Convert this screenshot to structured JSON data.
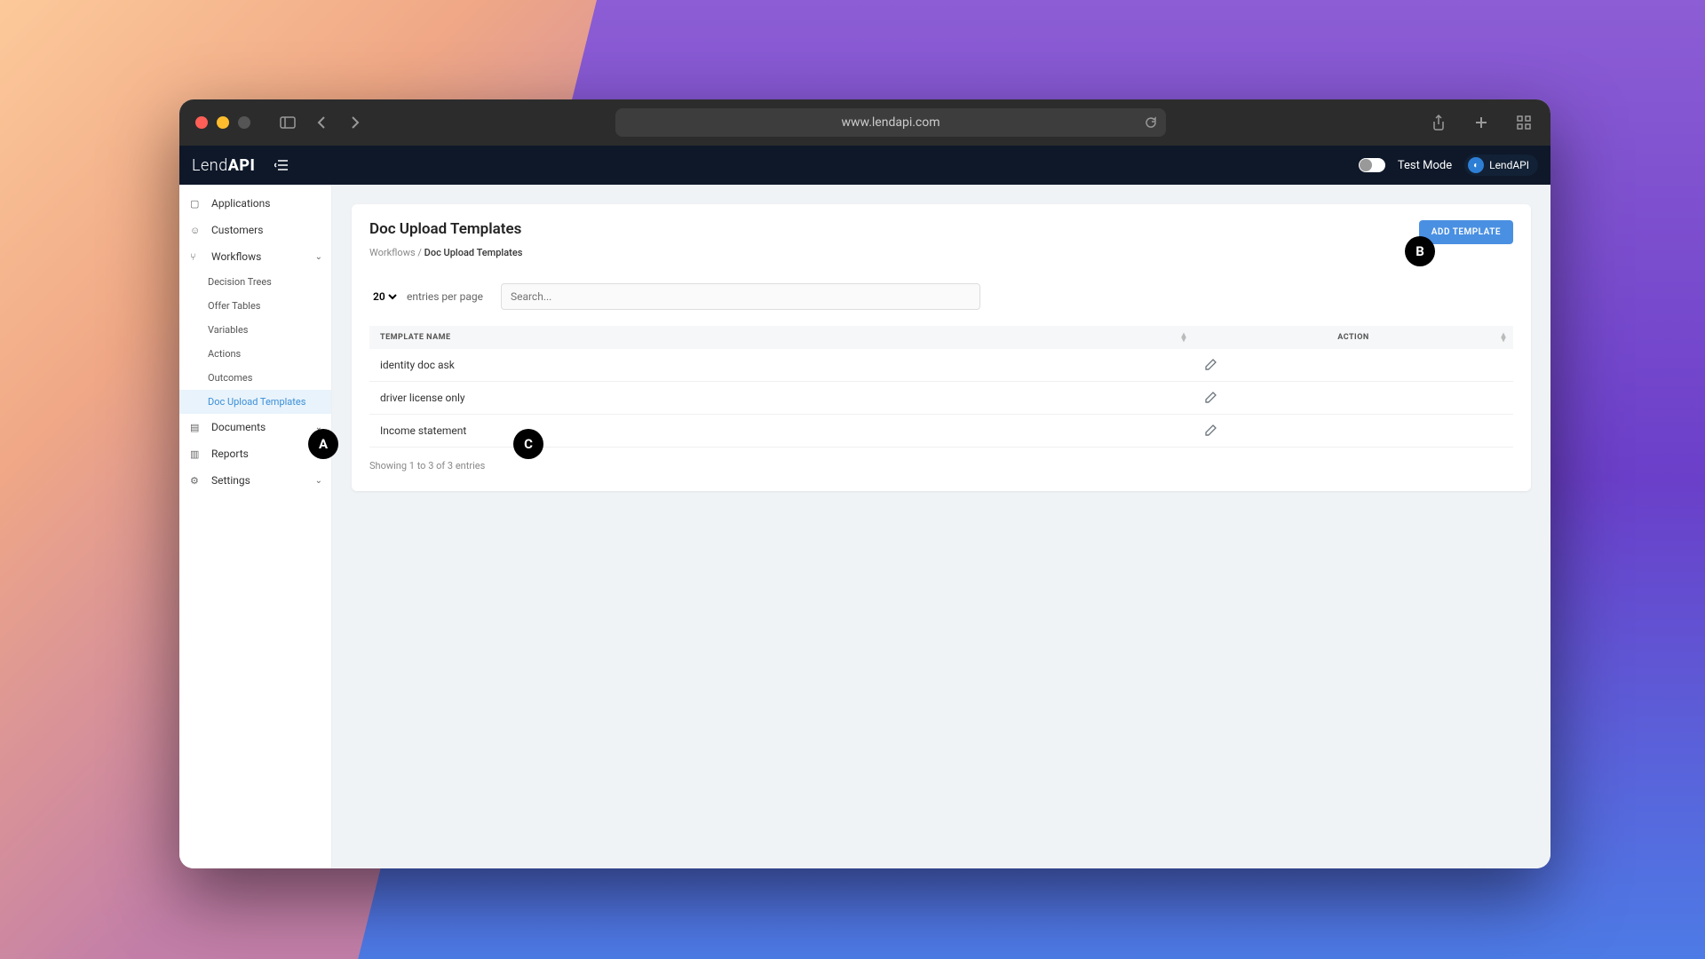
{
  "browser": {
    "url": "www.lendapi.com"
  },
  "header": {
    "logo_light": "Lend",
    "logo_bold": "API",
    "test_mode_label": "Test Mode",
    "user_label": "LendAPI"
  },
  "sidebar": {
    "applications": "Applications",
    "customers": "Customers",
    "workflows": "Workflows",
    "workflow_children": {
      "decision_trees": "Decision Trees",
      "offer_tables": "Offer Tables",
      "variables": "Variables",
      "actions": "Actions",
      "outcomes": "Outcomes",
      "doc_upload_templates": "Doc Upload Templates"
    },
    "documents": "Documents",
    "reports": "Reports",
    "settings": "Settings"
  },
  "page": {
    "title": "Doc Upload Templates",
    "breadcrumb_parent": "Workflows",
    "breadcrumb_sep": " / ",
    "breadcrumb_current": "Doc Upload Templates",
    "add_button": "ADD TEMPLATE",
    "entries_value": "20",
    "entries_label": "entries per page",
    "search_placeholder": "Search...",
    "columns": {
      "name": "TEMPLATE NAME",
      "action": "ACTION"
    },
    "rows": [
      {
        "name": "identity doc ask"
      },
      {
        "name": "driver license only"
      },
      {
        "name": "Income statement"
      }
    ],
    "footer": "Showing 1 to 3 of 3 entries"
  },
  "callouts": {
    "a": "A",
    "b": "B",
    "c": "C"
  }
}
